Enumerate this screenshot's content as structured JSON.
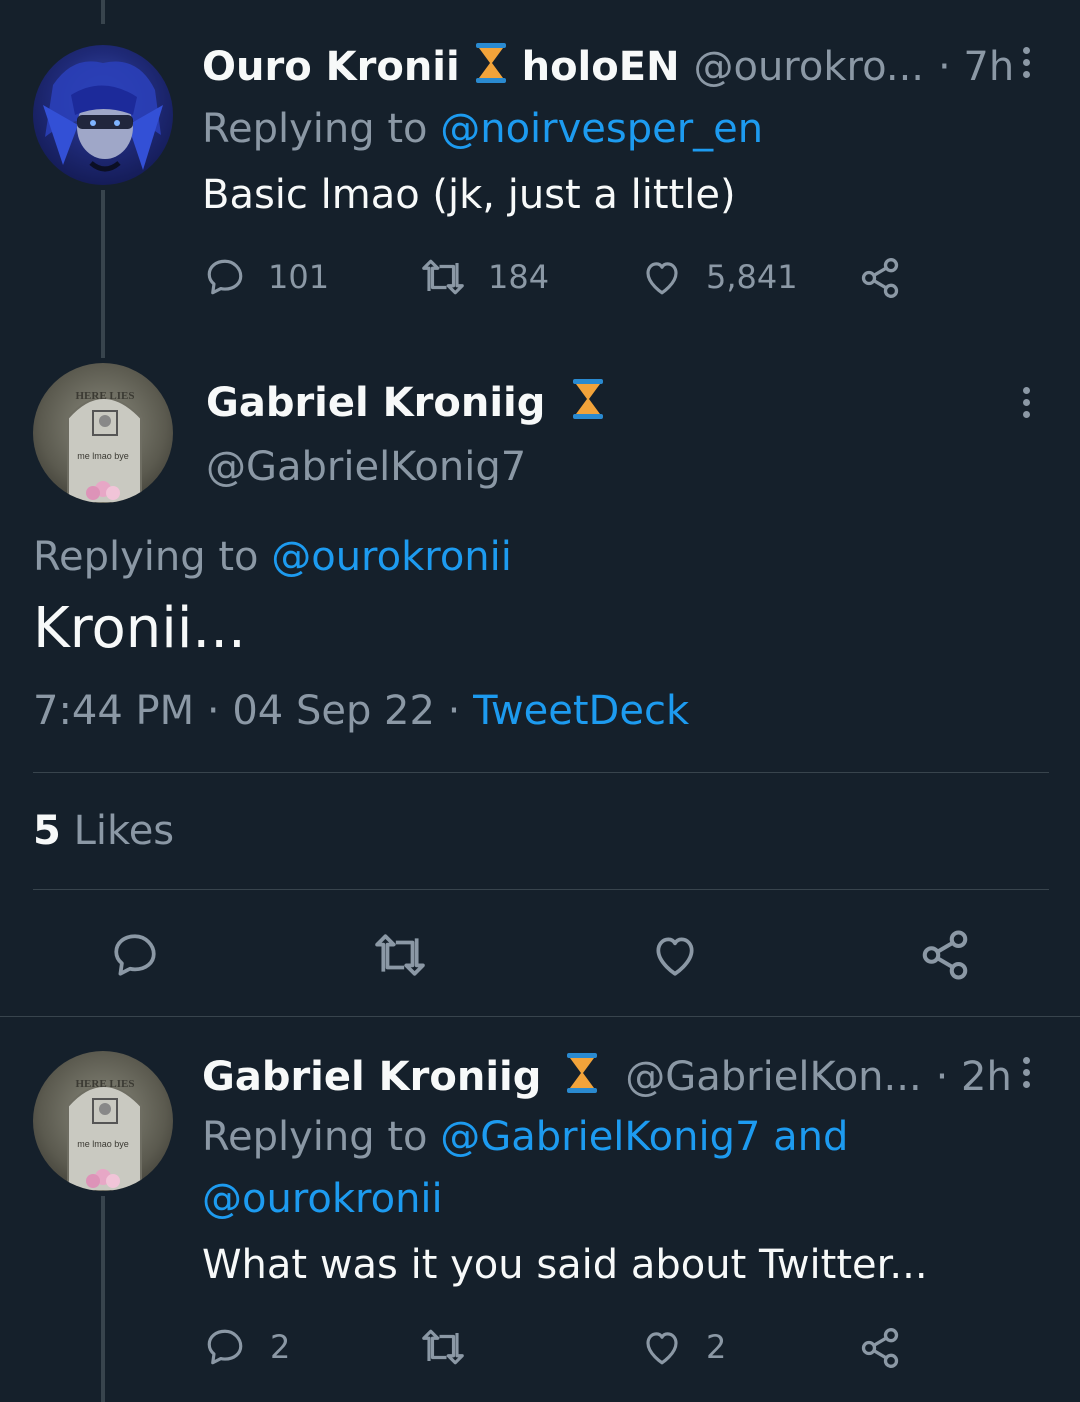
{
  "colors": {
    "background": "#15202b",
    "text": "#f7f9f9",
    "muted": "#8b98a5",
    "link": "#1d9bf0",
    "border": "#38444d",
    "hourglass_sand": "#f2a33a",
    "hourglass_frame": "#2a8ad0"
  },
  "tweet1": {
    "display_name": "Ouro Kronii",
    "name_suffix": "holoEN",
    "handle": "@ourokro...",
    "time": "· 7h",
    "replying_prefix": "Replying to",
    "replying_to": "@noirvesper_en",
    "text": "Basic lmao (jk, just a little)",
    "replies": "101",
    "retweets": "184",
    "likes": "5,841",
    "icons": [
      "reply-icon",
      "retweet-icon",
      "like-icon",
      "share-icon",
      "more-icon",
      "hourglass-icon"
    ]
  },
  "main_tweet": {
    "display_name": "Gabriel Kroniig",
    "handle": "@GabrielKonig7",
    "avatar_text_top": "HERE LIES",
    "avatar_text_bottom": "me lmao bye",
    "replying_prefix": "Replying to",
    "replying_to": "@ourokronii",
    "text": "Kronii...",
    "time": "7:44 PM",
    "date": "04 Sep 22",
    "source": "TweetDeck",
    "separator": "·",
    "likes_count": "5",
    "likes_label": "Likes"
  },
  "tweet3": {
    "display_name": "Gabriel Kroniig",
    "handle": "@GabrielKon...",
    "time": "· 2h",
    "replying_prefix": "Replying to",
    "replying_to_1": "@GabrielKonig7 and",
    "replying_to_2": "@ourokronii",
    "text": "What was it you said about Twitter...",
    "replies": "2",
    "likes": "2"
  }
}
